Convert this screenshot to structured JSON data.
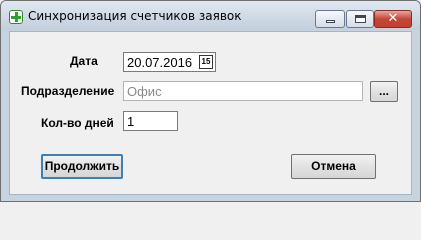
{
  "window": {
    "title": "Синхронизация счетчиков заявок",
    "close_glyph": "✕"
  },
  "form": {
    "date": {
      "label": "Дата",
      "value": "20.07.2016",
      "calendar_icon_text": "15"
    },
    "department": {
      "label": "Подразделение",
      "value": "Офис",
      "browse_label": "..."
    },
    "days": {
      "label": "Кол-во дней",
      "value": "1"
    }
  },
  "buttons": {
    "continue_label": "Продолжить",
    "cancel_label": "Отмена"
  },
  "colors": {
    "title_gradient_top": "#dfe8f2",
    "title_gradient_bottom": "#c3cfdd",
    "close_button": "#c5473a",
    "client_bg": "#f0f0f0",
    "default_button_border": "#3c7fb1"
  },
  "icons": {
    "app": "green-plus-icon",
    "minimize": "minimize-icon",
    "maximize": "maximize-icon",
    "close": "close-icon",
    "calendar": "calendar-icon"
  }
}
